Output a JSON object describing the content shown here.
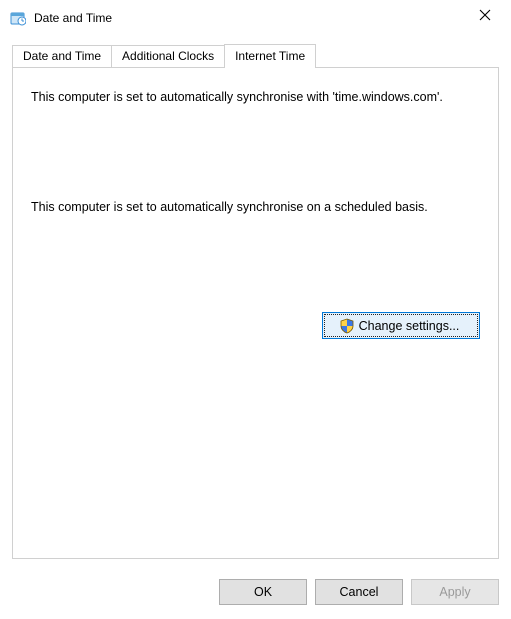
{
  "window": {
    "title": "Date and Time"
  },
  "tabs": {
    "items": [
      {
        "label": "Date and Time"
      },
      {
        "label": "Additional Clocks"
      },
      {
        "label": "Internet Time"
      }
    ],
    "active_index": 2
  },
  "panel": {
    "sync_server_text": "This computer is set to automatically synchronise with 'time.windows.com'.",
    "sync_schedule_text": "This computer is set to automatically synchronise on a scheduled basis.",
    "change_settings_label": "Change settings..."
  },
  "buttons": {
    "ok": "OK",
    "cancel": "Cancel",
    "apply": "Apply"
  }
}
